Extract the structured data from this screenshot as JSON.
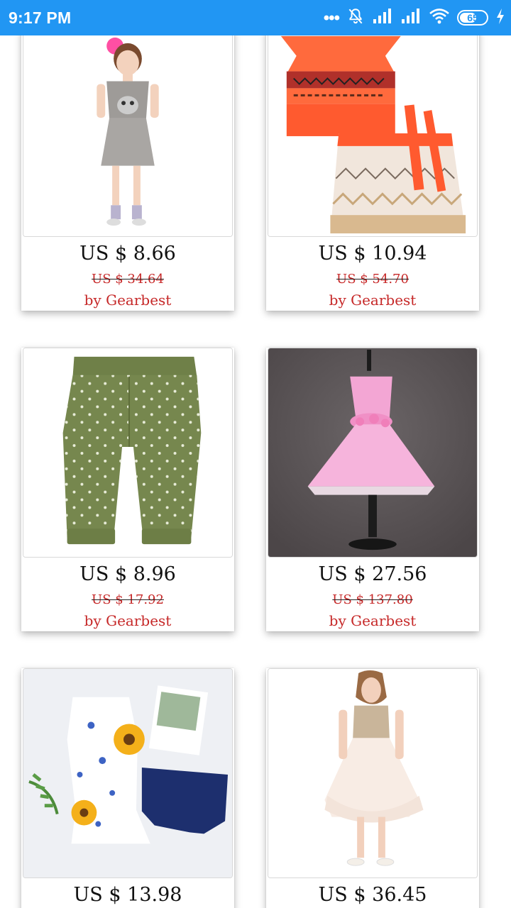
{
  "status_bar": {
    "time": "9:17 PM",
    "battery": "65",
    "battery_level": 0.65,
    "icons": [
      "more-dots-icon",
      "mute-bell-icon",
      "signal-icon",
      "signal-icon",
      "wifi-icon",
      "battery-icon",
      "charging-bolt-icon"
    ]
  },
  "colors": {
    "status_bar": "#2196f3",
    "seller_text": "#c62828",
    "price_text": "#111111"
  },
  "products": [
    {
      "price": "US $ 8.66",
      "old_price": "US $ 34.64",
      "seller": "by Gearbest",
      "image": "girl-cat-tshirt-dress"
    },
    {
      "price": "US $ 10.94",
      "old_price": "US $ 54.70",
      "seller": "by Gearbest",
      "image": "tribal-top-skirt-set"
    },
    {
      "price": "US $ 8.96",
      "old_price": "US $ 17.92",
      "seller": "by Gearbest",
      "image": "green-polka-dot-pants"
    },
    {
      "price": "US $ 27.56",
      "old_price": "US $ 137.80",
      "seller": "by Gearbest",
      "image": "pink-tulle-party-dress"
    },
    {
      "price": "US $ 13.98",
      "old_price": "",
      "seller": "",
      "image": "sunflower-romper-set"
    },
    {
      "price": "US $ 36.45",
      "old_price": "",
      "seller": "",
      "image": "girl-champagne-dress"
    }
  ]
}
